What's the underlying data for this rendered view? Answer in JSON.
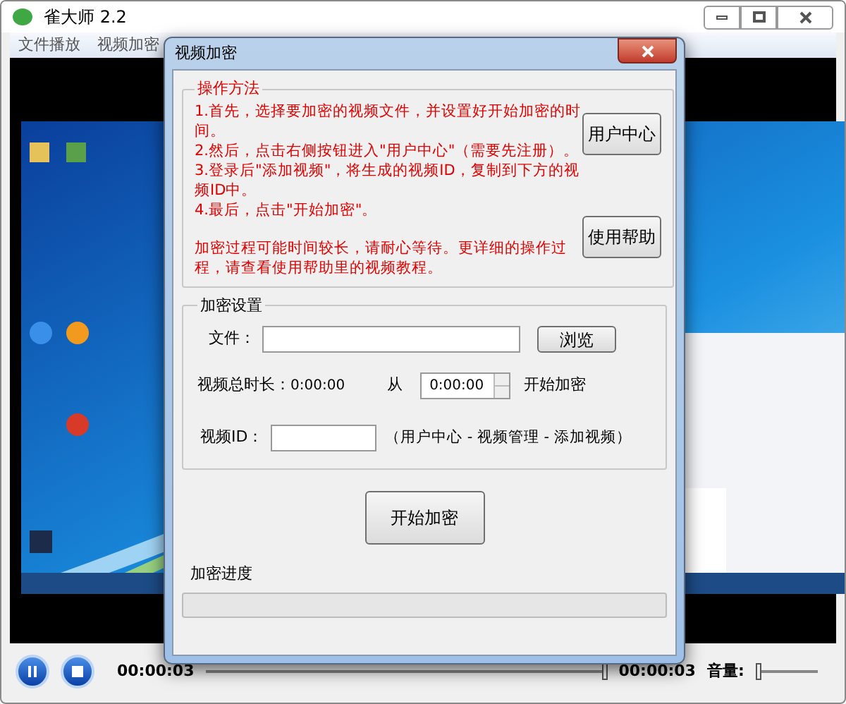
{
  "window": {
    "title": "雀大师 2.2"
  },
  "menu": [
    {
      "label": "文件播放"
    },
    {
      "label": "视频加密"
    }
  ],
  "dialog": {
    "title": "视频加密",
    "method_group": {
      "title": "操作方法",
      "steps": [
        "1.首先，选择要加密的视频文件，并设置好开始加密的时间。",
        "2.然后，点击右侧按钮进入\"用户中心\"（需要先注册）。",
        "3.登录后\"添加视频\"，将生成的视频ID，复制到下方的视频ID中。",
        "4.最后，点击\"开始加密\"。"
      ],
      "note": "加密过程可能时间较长，请耐心等待。更详细的操作过程，请查看使用帮助里的视频教程。",
      "buttons": [
        "用户中心",
        "使用帮助"
      ]
    },
    "settings_group": {
      "title": "加密设置",
      "file_label": "文件：",
      "browse_button": "浏览",
      "duration_label": "视频总时长：",
      "duration_value": "0:00:00",
      "from_label": "从",
      "start_time": "0:00:00",
      "start_suffix": "开始加密",
      "id_label": "视频ID：",
      "id_hint": "（用户中心 - 视频管理 - 添加视频）"
    },
    "start_button": "开始加密",
    "progress": {
      "label": "加密进度",
      "level": 0
    }
  },
  "player": {
    "elapsed": "00:00:03",
    "seek": {
      "level": 1
    },
    "total": "00:00:03",
    "volume_label": "音量:",
    "volume": {
      "level": 0
    }
  }
}
